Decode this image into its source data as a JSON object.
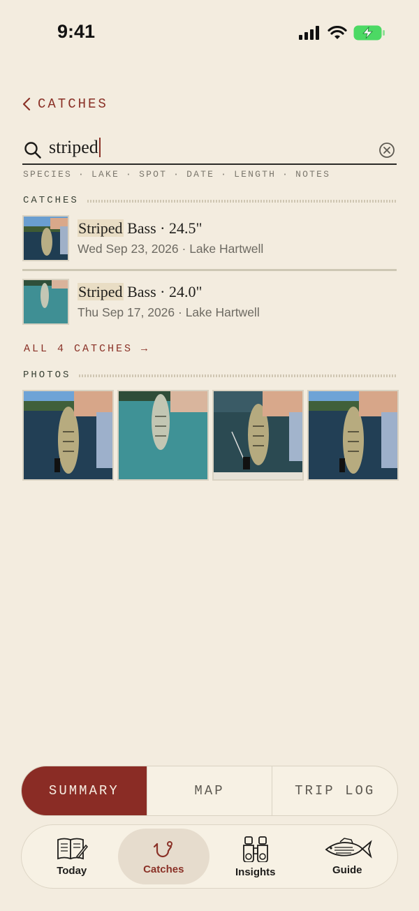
{
  "status": {
    "time": "9:41"
  },
  "nav": {
    "back_label": "CATCHES"
  },
  "search": {
    "value": "striped"
  },
  "filters": [
    "SPECIES",
    "LAKE",
    "SPOT",
    "DATE",
    "LENGTH",
    "NOTES"
  ],
  "sections": {
    "catches": "CATCHES",
    "photos": "PHOTOS"
  },
  "catches": [
    {
      "title_match": "Striped",
      "title_rest": " Bass · 24.5\"",
      "subtitle": "Wed Sep 23, 2026 · Lake Hartwell"
    },
    {
      "title_match": "Striped",
      "title_rest": " Bass · 24.0\"",
      "subtitle": "Thu Sep 17, 2026 · Lake Hartwell"
    }
  ],
  "all_link": "ALL 4 CATCHES →",
  "segments": [
    "SUMMARY",
    "MAP",
    "TRIP LOG"
  ],
  "tabs": [
    {
      "label": "Today",
      "icon": "journal-icon"
    },
    {
      "label": "Catches",
      "icon": "hook-icon"
    },
    {
      "label": "Insights",
      "icon": "binoculars-icon"
    },
    {
      "label": "Guide",
      "icon": "fish-icon"
    }
  ],
  "colors": {
    "accent": "#8a2c25",
    "background": "#f3ecdf"
  }
}
